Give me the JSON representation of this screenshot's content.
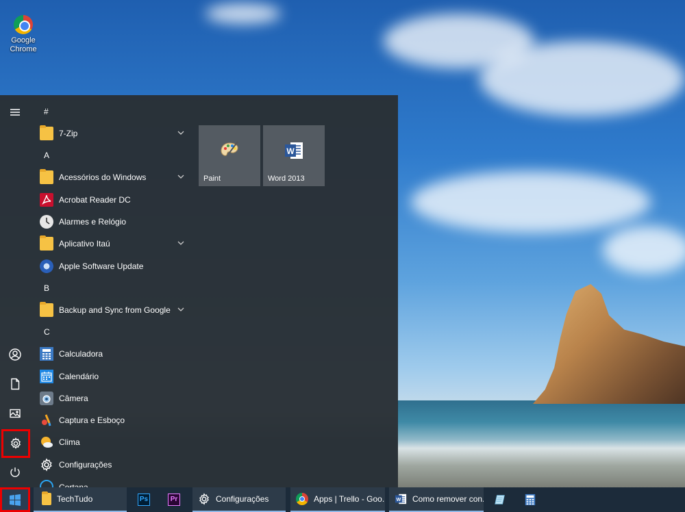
{
  "desktop": {
    "icons": [
      {
        "label": "Google Chrome",
        "icon": "chrome-icon"
      }
    ]
  },
  "start_menu": {
    "rail": [
      {
        "name": "hamburger-icon"
      },
      {
        "name": "user-icon"
      },
      {
        "name": "documents-icon"
      },
      {
        "name": "pictures-icon"
      },
      {
        "name": "settings-gear-icon"
      },
      {
        "name": "power-icon"
      }
    ],
    "list": [
      {
        "type": "group",
        "label": "#"
      },
      {
        "type": "app",
        "label": "7-Zip",
        "icon": "folder-icon",
        "expandable": true
      },
      {
        "type": "group",
        "label": "A"
      },
      {
        "type": "app",
        "label": "Acessórios do Windows",
        "icon": "folder-icon",
        "expandable": true
      },
      {
        "type": "app",
        "label": "Acrobat Reader DC",
        "icon": "acrobat-icon"
      },
      {
        "type": "app",
        "label": "Alarmes e Relógio",
        "icon": "clock-icon"
      },
      {
        "type": "app",
        "label": "Aplicativo Itaú",
        "icon": "folder-icon",
        "expandable": true
      },
      {
        "type": "app",
        "label": "Apple Software Update",
        "icon": "apple-update-icon"
      },
      {
        "type": "group",
        "label": "B"
      },
      {
        "type": "app",
        "label": "Backup and Sync from Google",
        "icon": "folder-icon",
        "expandable": true
      },
      {
        "type": "group",
        "label": "C"
      },
      {
        "type": "app",
        "label": "Calculadora",
        "icon": "calculator-icon"
      },
      {
        "type": "app",
        "label": "Calendário",
        "icon": "calendar-icon"
      },
      {
        "type": "app",
        "label": "Câmera",
        "icon": "camera-icon"
      },
      {
        "type": "app",
        "label": "Captura e Esboço",
        "icon": "snip-sketch-icon"
      },
      {
        "type": "app",
        "label": "Clima",
        "icon": "weather-icon"
      },
      {
        "type": "app",
        "label": "Configurações",
        "icon": "gear-icon"
      },
      {
        "type": "app",
        "label": "Cortana",
        "icon": "cortana-icon"
      }
    ],
    "tiles": [
      {
        "label": "Paint",
        "icon": "paint-palette-icon"
      },
      {
        "label": "Word 2013",
        "icon": "word-icon"
      }
    ]
  },
  "taskbar": {
    "items": [
      {
        "label": "",
        "icon": "windows-start-icon"
      },
      {
        "label": "TechTudo",
        "icon": "folder-icon"
      },
      {
        "label": "",
        "icon": "photoshop-icon"
      },
      {
        "label": "",
        "icon": "premiere-icon"
      },
      {
        "label": "Configurações",
        "icon": "gear-icon"
      },
      {
        "label": "Apps | Trello - Goo...",
        "icon": "chrome-icon"
      },
      {
        "label": "Como remover con...",
        "icon": "word-icon"
      },
      {
        "label": "",
        "icon": "notepad-icon"
      },
      {
        "label": "",
        "icon": "calculator-icon"
      }
    ]
  },
  "colors": {
    "menu_bg": "#292f35",
    "taskbar_bg": "#1c2b3a",
    "highlight": "#e00000",
    "tile_bg": "#787e84"
  }
}
